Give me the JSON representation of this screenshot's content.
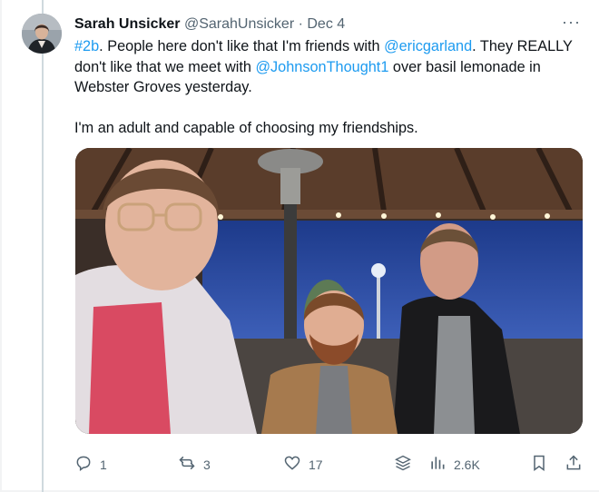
{
  "tweet": {
    "author_name": "Sarah Unsicker",
    "handle": "@SarahUnsicker",
    "separator": "·",
    "date": "Dec 4",
    "more": "···",
    "text_segments": [
      {
        "text": "#2b",
        "type": "link"
      },
      {
        "text": ". People here don't like that I'm friends with ",
        "type": "plain"
      },
      {
        "text": "@ericgarland",
        "type": "link"
      },
      {
        "text": ". They REALLY don't like that we meet with ",
        "type": "plain"
      },
      {
        "text": "@JohnsonThought1",
        "type": "link"
      },
      {
        "text": " over basil lemonade in Webster Groves yesterday.",
        "type": "plain"
      }
    ],
    "paragraph2": "I'm an adult and capable of choosing my friendships.",
    "metrics": {
      "replies": "1",
      "reposts": "3",
      "likes": "17",
      "views": "2.6K"
    }
  },
  "colors": {
    "link": "#1d9bf0",
    "text": "#0f1419",
    "muted": "#536471"
  },
  "icons": [
    "reply-icon",
    "repost-icon",
    "like-icon",
    "stack-icon",
    "views-icon",
    "bookmark-icon",
    "share-icon",
    "more-icon"
  ]
}
